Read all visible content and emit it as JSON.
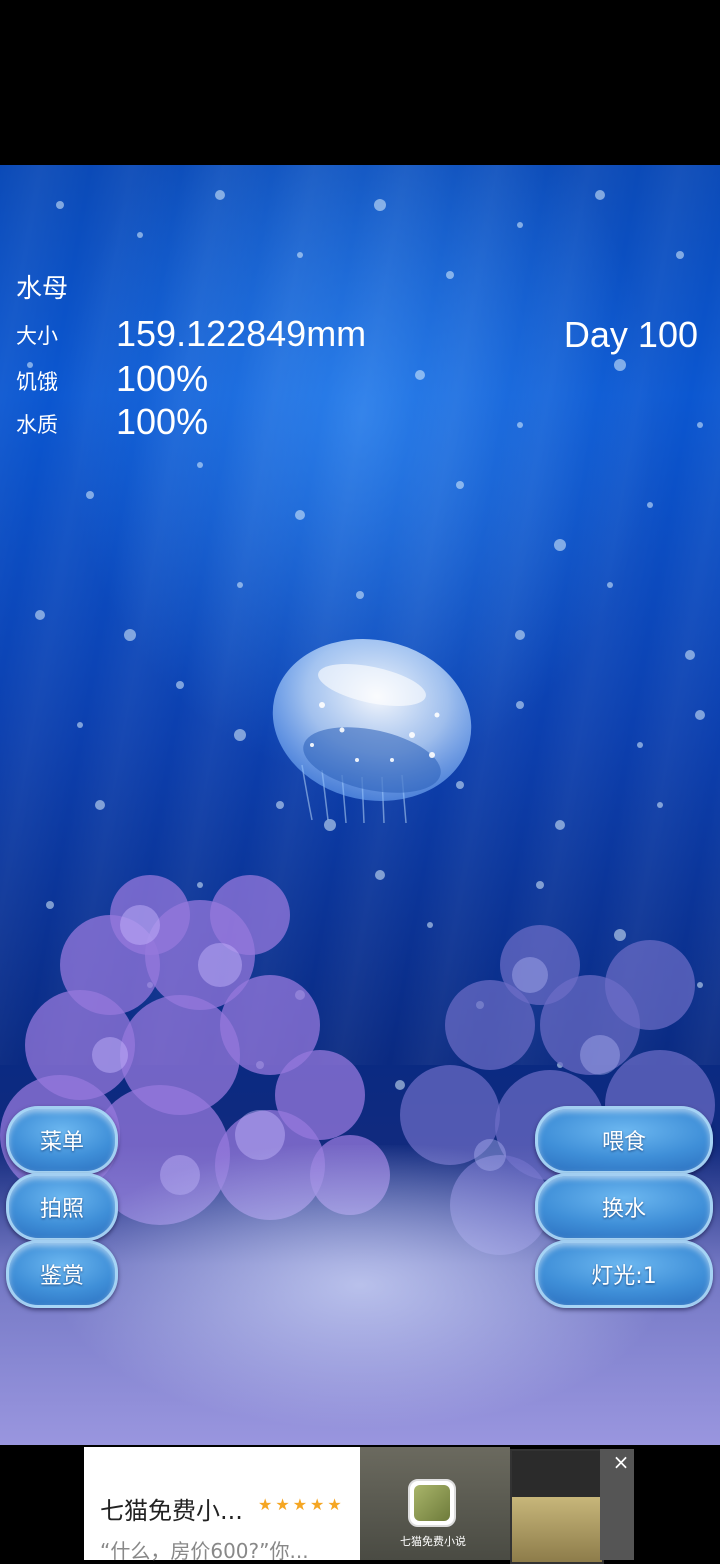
{
  "hud": {
    "name": "水母",
    "size_label": "大小",
    "size_value": "159.122849mm",
    "hunger_label": "饥饿",
    "hunger_value": "100%",
    "water_label": "水质",
    "water_value": "100%",
    "day": "Day 100"
  },
  "buttons": {
    "menu": "菜单",
    "photo": "拍照",
    "appreciate": "鉴赏",
    "feed": "喂食",
    "change_water": "换水",
    "light": "灯光:1"
  },
  "ad": {
    "title": "七猫免费小...",
    "stars": "★★★★★",
    "subtitle": "“什么，房价600?”你...",
    "app_name": "七猫免费小说",
    "close": "×"
  },
  "colors": {
    "water_top": "#0b57d1",
    "water_deep": "#0a2a82",
    "button_fill": "#3f8fd8",
    "star": "#f5a623"
  },
  "icons": [
    "close-icon",
    "app-icon",
    "jellyfish",
    "coral",
    "bubbles"
  ]
}
